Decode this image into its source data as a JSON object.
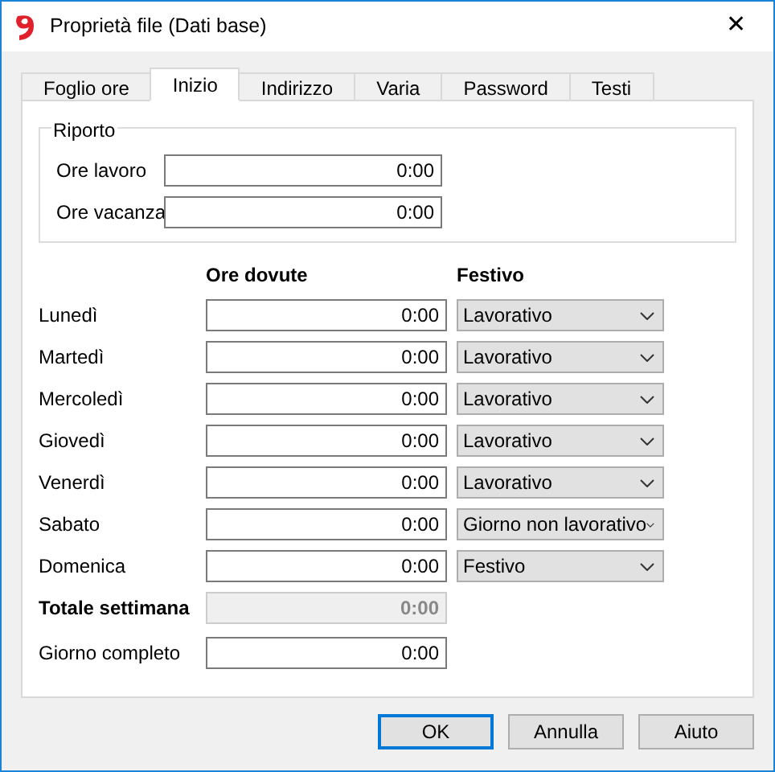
{
  "window": {
    "title": "Proprietà file (Dati base)",
    "close": "✕"
  },
  "tabs": [
    {
      "label": "Foglio ore",
      "selected": false
    },
    {
      "label": "Inizio",
      "selected": true
    },
    {
      "label": "Indirizzo",
      "selected": false
    },
    {
      "label": "Varia",
      "selected": false
    },
    {
      "label": "Password",
      "selected": false
    },
    {
      "label": "Testi",
      "selected": false
    }
  ],
  "riporto": {
    "title": "Riporto",
    "fields": [
      {
        "label": "Ore lavoro",
        "value": "0:00"
      },
      {
        "label": "Ore vacanza",
        "value": "0:00"
      }
    ]
  },
  "columns": [
    "Ore dovute",
    "Festivo"
  ],
  "days": [
    {
      "label": "Lunedì",
      "value": "0:00",
      "festivo": "Lavorativo"
    },
    {
      "label": "Martedì",
      "value": "0:00",
      "festivo": "Lavorativo"
    },
    {
      "label": "Mercoledì",
      "value": "0:00",
      "festivo": "Lavorativo"
    },
    {
      "label": "Giovedì",
      "value": "0:00",
      "festivo": "Lavorativo"
    },
    {
      "label": "Venerdì",
      "value": "0:00",
      "festivo": "Lavorativo"
    },
    {
      "label": "Sabato",
      "value": "0:00",
      "festivo": "Giorno non lavorativo"
    },
    {
      "label": "Domenica",
      "value": "0:00",
      "festivo": "Festivo"
    }
  ],
  "totale": {
    "label": "Totale settimana",
    "value": "0:00",
    "disabled": true
  },
  "giorno_completo": {
    "label": "Giorno completo",
    "value": "0:00",
    "disabled": false
  },
  "buttons": [
    {
      "label": "OK",
      "default": true
    },
    {
      "label": "Annulla",
      "default": false
    },
    {
      "label": "Aiuto",
      "default": false
    }
  ]
}
